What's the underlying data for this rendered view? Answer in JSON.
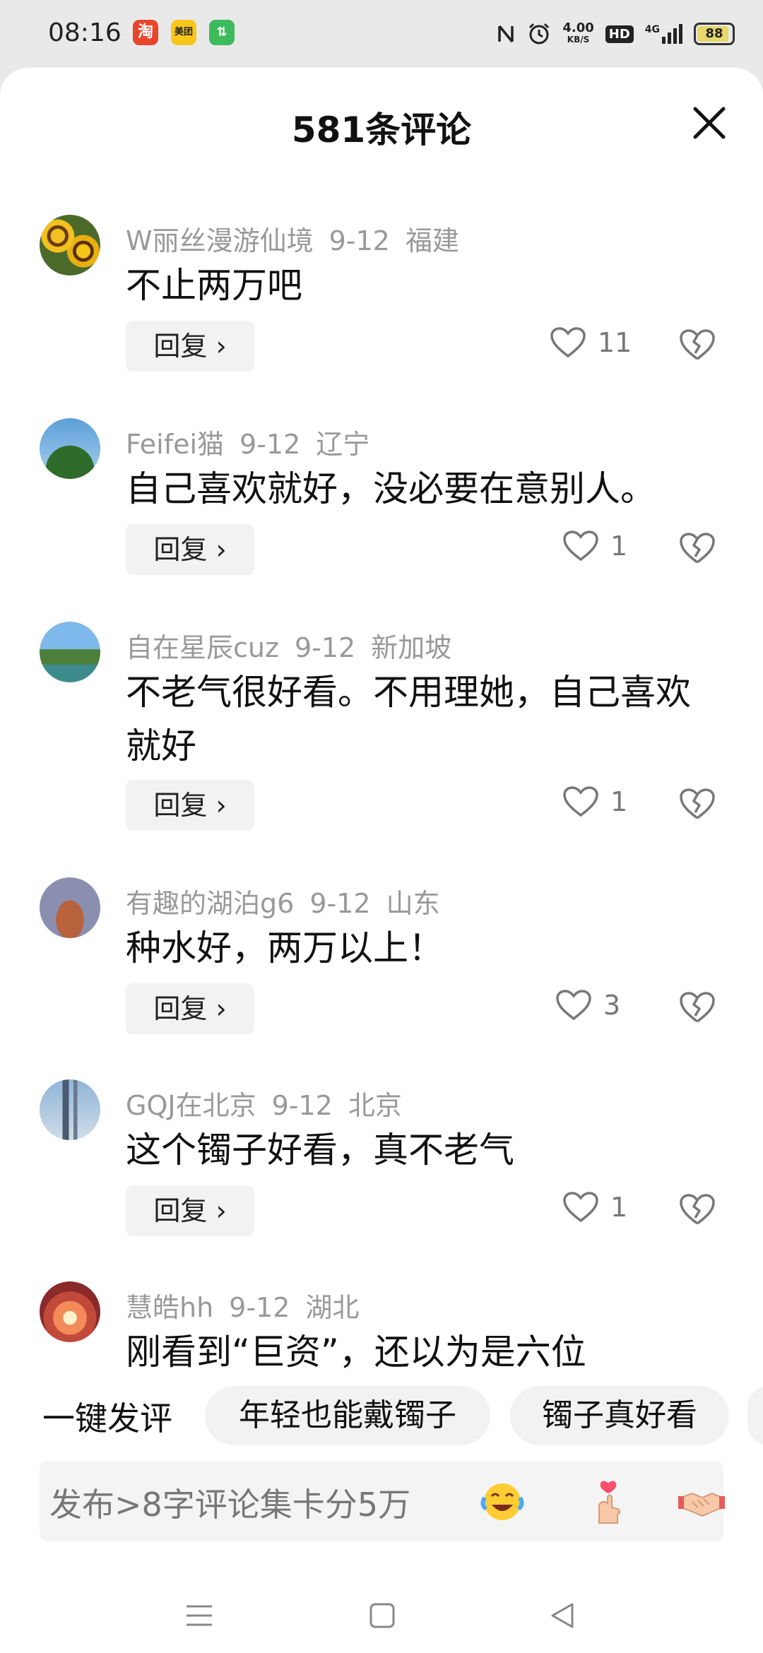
{
  "status_bar": {
    "time": "08:16",
    "apps": [
      "淘",
      "美团",
      "⇅"
    ],
    "net_speed_value": "4.00",
    "net_speed_unit": "KB/S",
    "hd": "HD",
    "signal": "4G",
    "battery": "88"
  },
  "sheet": {
    "title": "581条评论"
  },
  "comments": [
    {
      "user": "W丽丝漫游仙境",
      "date": "9-12",
      "location": "福建",
      "text": "不止两万吧",
      "reply_label": "回复 ›",
      "likes": "11"
    },
    {
      "user": "Feifei猫",
      "date": "9-12",
      "location": "辽宁",
      "text": "自己喜欢就好，没必要在意别人。",
      "reply_label": "回复 ›",
      "likes": "1"
    },
    {
      "user": "自在星辰cuz",
      "date": "9-12",
      "location": "新加坡",
      "text": "不老气很好看。不用理她，自己喜欢就好",
      "reply_label": "回复 ›",
      "likes": "1"
    },
    {
      "user": "有趣的湖泊g6",
      "date": "9-12",
      "location": "山东",
      "text": "种水好，两万以上！",
      "reply_label": "回复 ›",
      "likes": "3"
    },
    {
      "user": "GQJ在北京",
      "date": "9-12",
      "location": "北京",
      "text": "这个镯子好看，真不老气",
      "reply_label": "回复 ›",
      "likes": "1"
    },
    {
      "user": "慧皓hh",
      "date": "9-12",
      "location": "湖北",
      "text": "刚看到“巨资”，还以为是六位"
    }
  ],
  "quick_comment": {
    "label": "一键发评",
    "chips": [
      "年轻也能戴镯子",
      "镯子真好看"
    ]
  },
  "input": {
    "placeholder": "发布>8字评论集卡分5万"
  },
  "emojis": [
    "laugh-cry-emoji",
    "finger-heart-emoji",
    "handshake-emoji"
  ],
  "colors": {
    "taobao": "#e8452c",
    "meituan": "#f7c71c",
    "green_app": "#3dbb5c"
  }
}
